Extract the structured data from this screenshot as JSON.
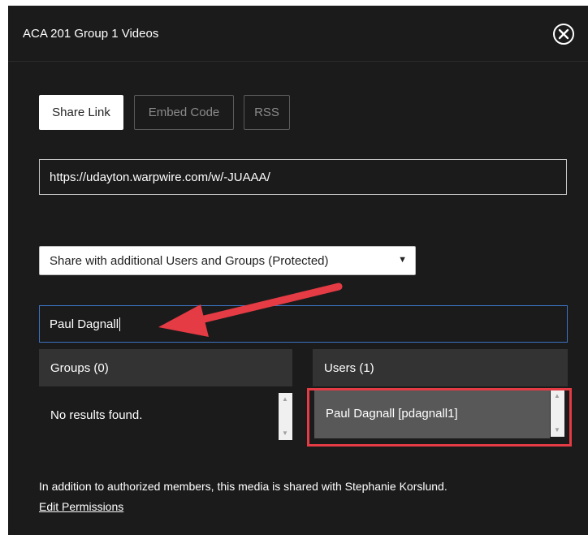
{
  "dialog": {
    "title": "ACA 201 Group 1 Videos",
    "close_icon": "close-circle-icon"
  },
  "tabs": [
    {
      "label": "Share Link",
      "active": true
    },
    {
      "label": "Embed Code",
      "active": false
    },
    {
      "label": "RSS",
      "active": false
    }
  ],
  "share_link": {
    "value": "https://udayton.warpwire.com/w/-JUAAA/"
  },
  "share_select": {
    "selected": "Share with additional Users and Groups (Protected)",
    "caret_icon": "caret-down-icon"
  },
  "search": {
    "value": "Paul Dagnall"
  },
  "annotation": {
    "arrow_color": "#e53b44",
    "highlight_color": "#e53b44"
  },
  "groups": {
    "header": "Groups (0)",
    "empty_message": "No results found."
  },
  "users": {
    "header": "Users (1)",
    "results": [
      "Paul Dagnall [pdagnall1]"
    ]
  },
  "footer": {
    "notice": "In addition to authorized members, this media is shared with Stephanie Korslund.",
    "edit_link": "Edit Permissions"
  }
}
